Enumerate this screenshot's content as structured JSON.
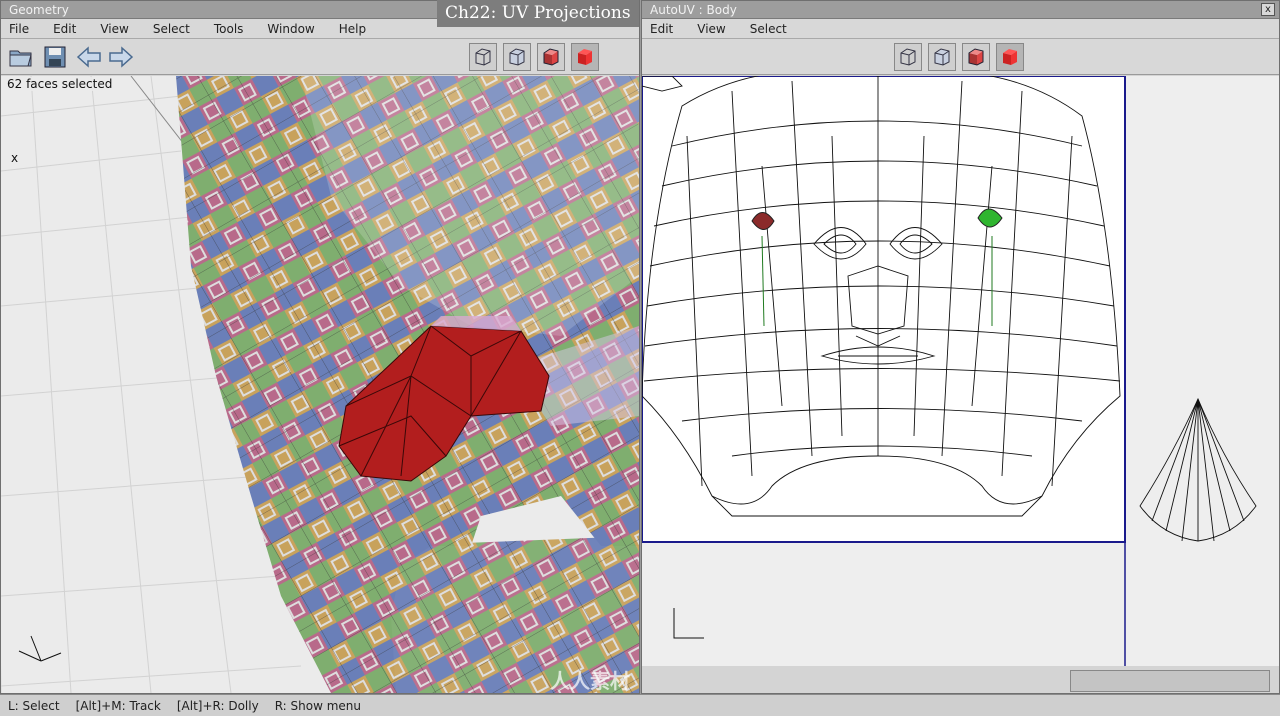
{
  "chapter_title": "Ch22: UV Projections",
  "geometry_window": {
    "title": "Geometry",
    "menu": [
      "File",
      "Edit",
      "View",
      "Select",
      "Tools",
      "Window",
      "Help"
    ],
    "selection_status": "62 faces selected",
    "axis_label": "x"
  },
  "autouv_window": {
    "title": "AutoUV : Body",
    "close_label": "x",
    "menu": [
      "Edit",
      "View",
      "Select"
    ]
  },
  "status_bar": {
    "items": [
      "L: Select",
      "[Alt]+M: Track",
      "[Alt]+R: Dolly",
      "R: Show menu"
    ]
  },
  "watermark": "人人素材",
  "colors": {
    "selection_red": "#b21e1e",
    "uv_border_blue": "#1a1a8c",
    "uv_green": "#2fb52f"
  }
}
